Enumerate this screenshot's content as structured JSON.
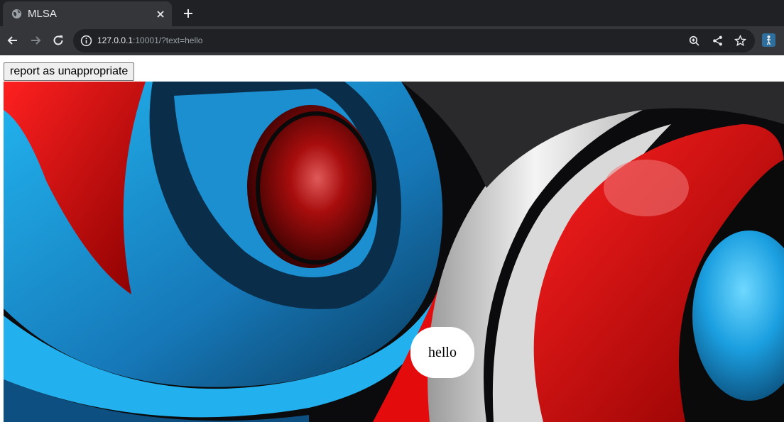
{
  "browser": {
    "tab_title": "MLSA",
    "url_host": "127.0.0.1",
    "url_rest": ":10001/?text=hello"
  },
  "page": {
    "report_button_label": "report as unappropriate",
    "bubble_text": "hello"
  },
  "colors": {
    "red": "#e30b0b",
    "blue": "#1aa3e0",
    "dark": "#0a0a0c"
  }
}
